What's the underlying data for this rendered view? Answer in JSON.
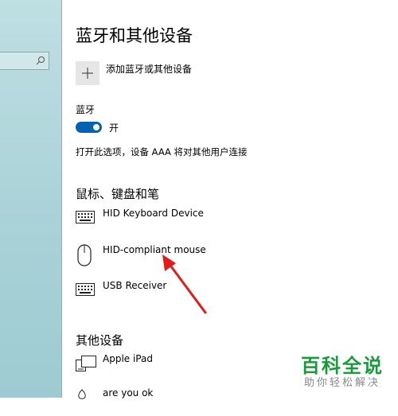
{
  "sidebar": {
    "search": {
      "placeholder": ""
    }
  },
  "page": {
    "title": "蓝牙和其他设备"
  },
  "add_device": {
    "label": "添加蓝牙或其他设备",
    "icon": "plus-icon"
  },
  "bluetooth": {
    "title": "蓝牙",
    "toggle_label": "开",
    "toggle_on": true,
    "description": "打开此选项，设备 AAA 将对其他用户连接"
  },
  "input_section": {
    "title": "鼠标、键盘和笔",
    "devices": [
      {
        "name": "HID Keyboard Device",
        "icon": "keyboard-icon"
      },
      {
        "name": "HID-compliant mouse",
        "icon": "mouse-icon"
      },
      {
        "name": "USB Receiver",
        "icon": "keyboard-icon"
      }
    ]
  },
  "other_section": {
    "title": "其他设备",
    "devices": [
      {
        "name": "Apple iPad",
        "icon": "tablet-icon"
      },
      {
        "name": "are you ok",
        "icon": "audio-icon"
      }
    ]
  },
  "watermark": {
    "brand": "百科全说",
    "slogan": "助你轻松解决"
  },
  "colors": {
    "accent": "#0063b1",
    "sidebar": "#a9d2d7",
    "watermark": "#1a9a3c"
  }
}
